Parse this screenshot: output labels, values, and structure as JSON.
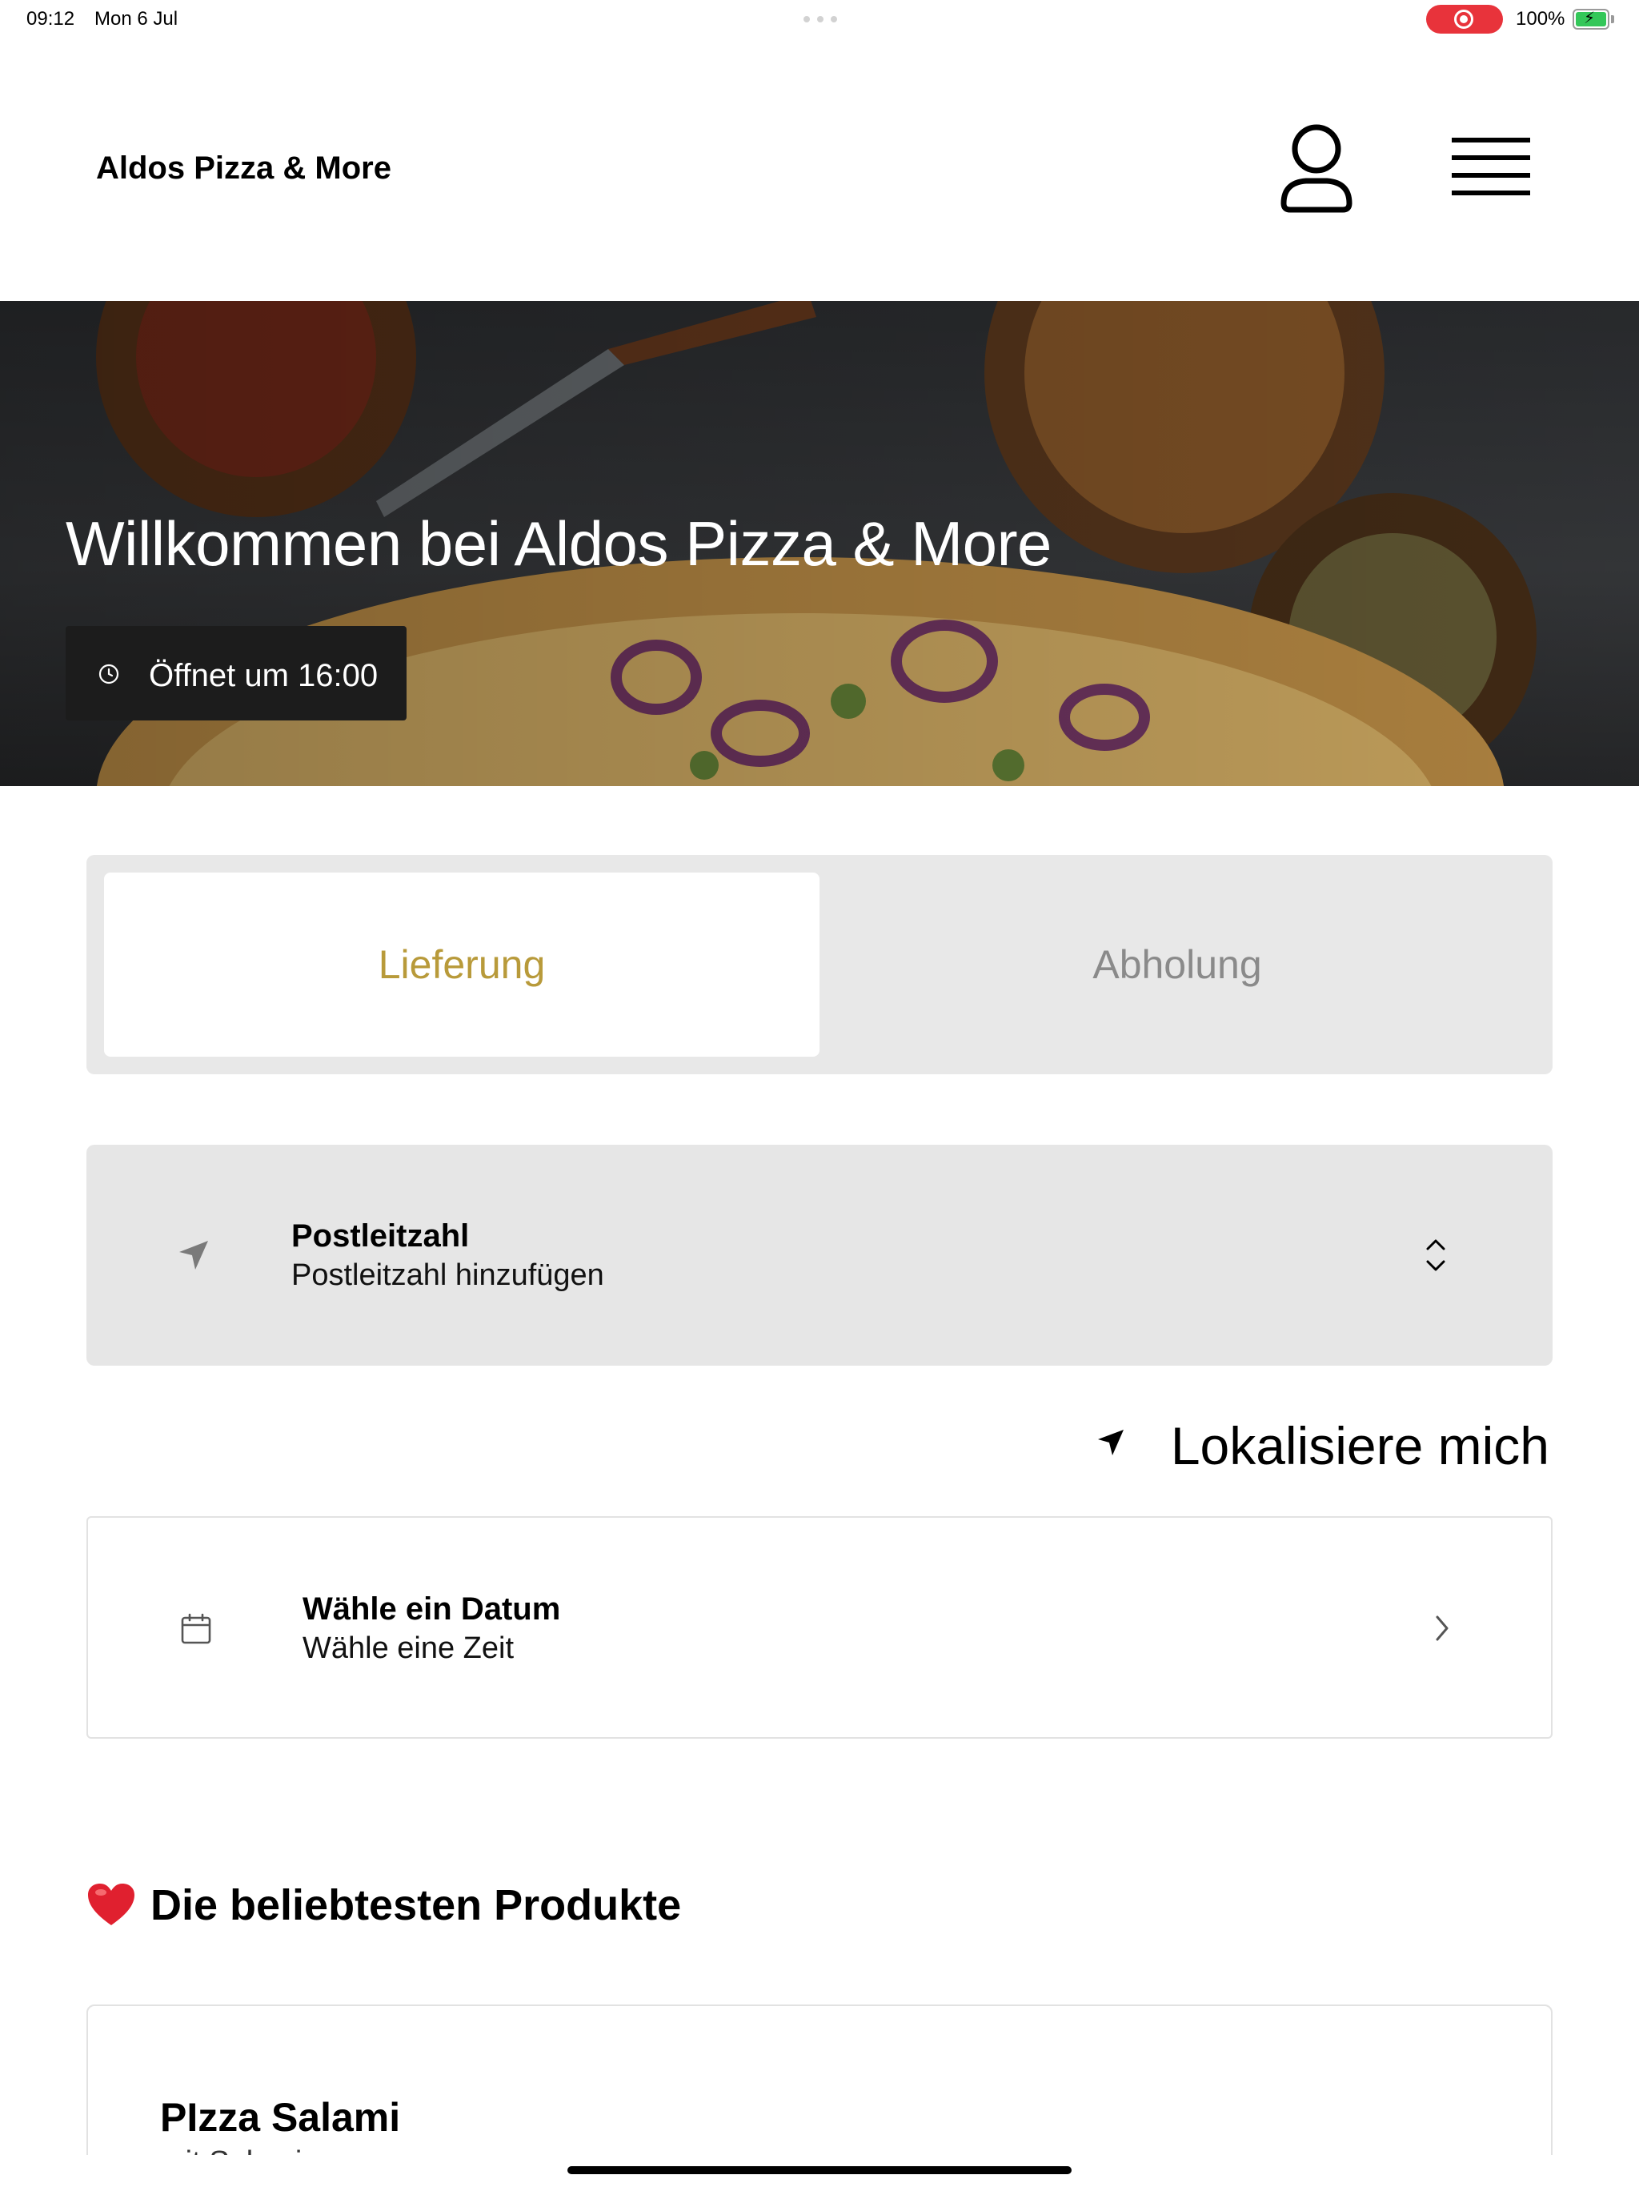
{
  "status_bar": {
    "time": "09:12",
    "date": "Mon 6 Jul",
    "battery": "100%",
    "recording_color": "#e8333b",
    "battery_color": "#34c759"
  },
  "header": {
    "brand": "Aldos Pizza & More",
    "user_icon": "user-icon",
    "menu_icon": "hamburger-menu-icon"
  },
  "hero": {
    "title": "Willkommen bei Aldos Pizza & More",
    "open_label": "Öffnet um 16:00",
    "clock_icon": "clock-icon"
  },
  "order_mode": {
    "tabs": [
      {
        "label": "Lieferung",
        "active": true
      },
      {
        "label": "Abholung",
        "active": false
      }
    ],
    "accent_color": "#b89a3a"
  },
  "postal": {
    "title": "Postleitzahl",
    "subtitle": "Postleitzahl hinzufügen",
    "icon": "location-arrow-icon",
    "trailing_icon": "up-down-chevron-icon"
  },
  "locate": {
    "label": "Lokalisiere mich",
    "icon": "location-arrow-icon"
  },
  "date_picker": {
    "title": "Wähle ein Datum",
    "subtitle": "Wähle eine Zeit",
    "icon": "calendar-icon",
    "trailing_icon": "chevron-right-icon"
  },
  "popular": {
    "heading": "Die beliebtesten Produkte",
    "icon": "heart-icon",
    "products": [
      {
        "name": "PIzza Salami",
        "description": "mit Salami"
      }
    ]
  }
}
